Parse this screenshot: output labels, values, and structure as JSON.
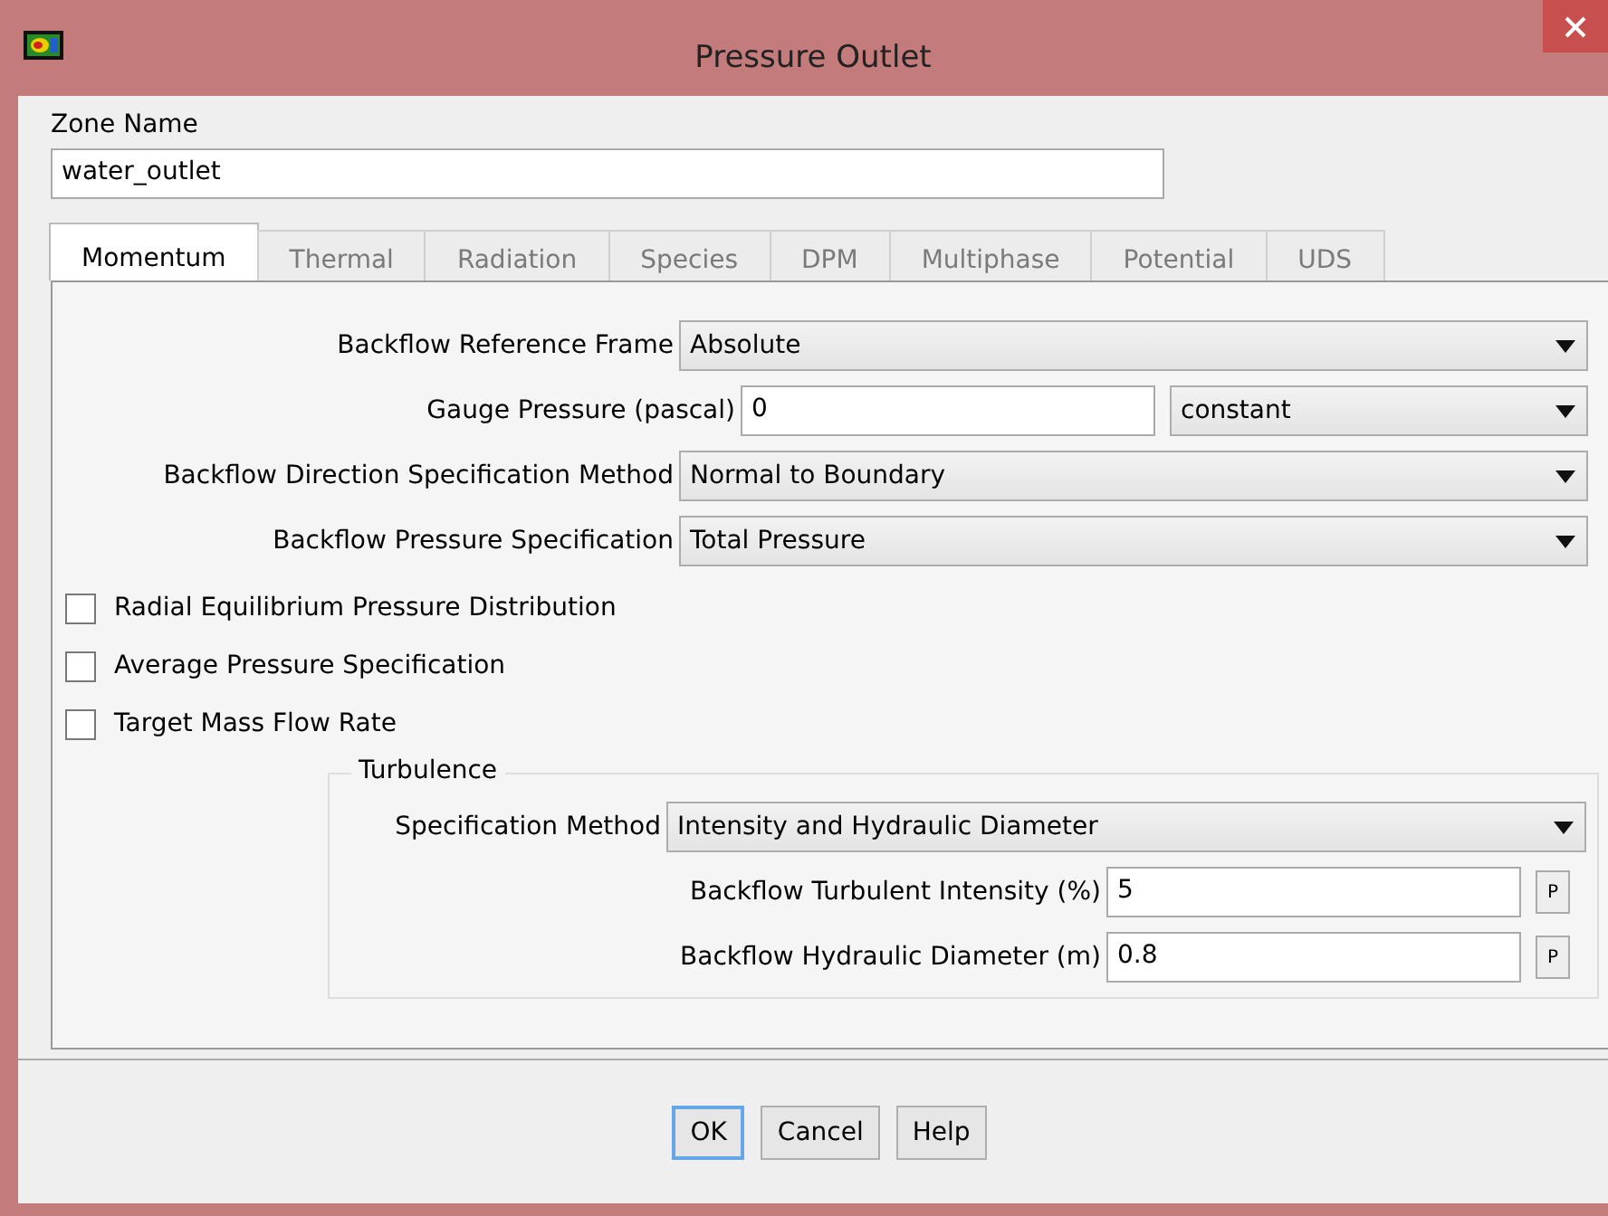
{
  "window": {
    "title": "Pressure Outlet"
  },
  "zone_name": {
    "label": "Zone Name",
    "value": "water_outlet"
  },
  "tabs": [
    {
      "label": "Momentum",
      "selected": true
    },
    {
      "label": "Thermal",
      "selected": false
    },
    {
      "label": "Radiation",
      "selected": false
    },
    {
      "label": "Species",
      "selected": false
    },
    {
      "label": "DPM",
      "selected": false
    },
    {
      "label": "Multiphase",
      "selected": false
    },
    {
      "label": "Potential",
      "selected": false
    },
    {
      "label": "UDS",
      "selected": false
    }
  ],
  "fields": [
    {
      "kind": "dropdown",
      "label": "Backflow Reference Frame",
      "value": "Absolute"
    },
    {
      "kind": "value_dropdown",
      "label": "Gauge Pressure (pascal)",
      "value": "0",
      "option": "constant"
    },
    {
      "kind": "dropdown",
      "label": "Backflow Direction Specification Method",
      "value": "Normal to Boundary"
    },
    {
      "kind": "dropdown",
      "label": "Backflow Pressure Specification",
      "value": "Total Pressure"
    }
  ],
  "checkboxes": [
    {
      "label": "Radial Equilibrium Pressure Distribution",
      "checked": false
    },
    {
      "label": "Average Pressure Specification",
      "checked": false
    },
    {
      "label": "Target Mass Flow Rate",
      "checked": false
    }
  ],
  "turbulence": {
    "title": "Turbulence",
    "method": {
      "label": "Specification Method",
      "value": "Intensity and Hydraulic Diameter"
    },
    "inputs": [
      {
        "label": "Backflow Turbulent Intensity (%)",
        "value": "5",
        "button": "P"
      },
      {
        "label": "Backflow Hydraulic Diameter (m)",
        "value": "0.8",
        "button": "P"
      }
    ]
  },
  "buttons": [
    {
      "label": "OK",
      "focused": true
    },
    {
      "label": "Cancel",
      "focused": false
    },
    {
      "label": "Help",
      "focused": false
    }
  ]
}
